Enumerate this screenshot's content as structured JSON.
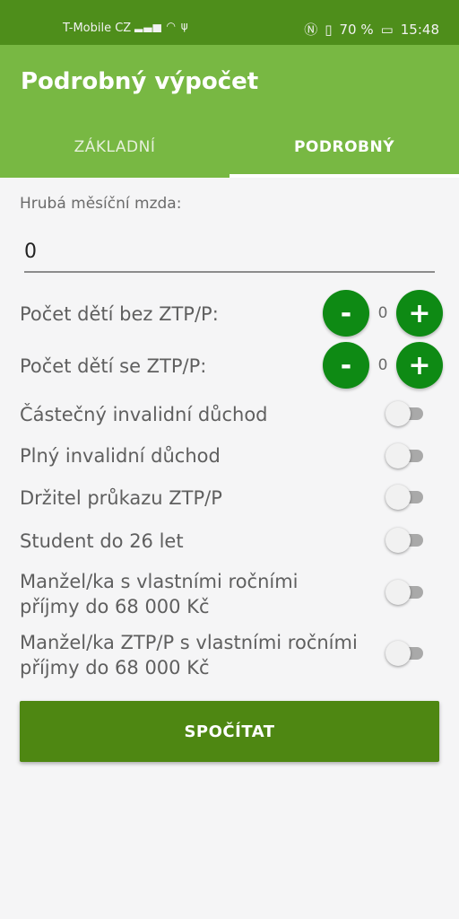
{
  "status": {
    "carrier": "T-Mobile CZ",
    "battery": "70 %",
    "time": "15:48"
  },
  "app": {
    "title": "Podrobný výpočet"
  },
  "tabs": [
    {
      "label": "ZÁKLADNÍ"
    },
    {
      "label": "PODROBNÝ"
    }
  ],
  "form": {
    "gross_label": "Hrubá měsíční mzda:",
    "gross_value": "0",
    "children_no_ztp_label": "Počet dětí bez ZTP/P:",
    "children_no_ztp_count": "0",
    "children_ztp_label": "Počet dětí se ZTP/P:",
    "children_ztp_count": "0",
    "minus": "-",
    "plus": "+",
    "toggles": [
      {
        "label": "Částečný invalidní důchod"
      },
      {
        "label": "Plný invalidní důchod"
      },
      {
        "label": "Držitel průkazu ZTP/P"
      },
      {
        "label": "Student do 26 let"
      },
      {
        "label": "Manžel/ka s vlastními ročními příjmy do 68 000 Kč"
      },
      {
        "label": "Manžel/ka ZTP/P s vlastními ročními příjmy do 68 000 Kč"
      }
    ]
  },
  "actions": {
    "calculate": "SPOČÍTAT"
  }
}
